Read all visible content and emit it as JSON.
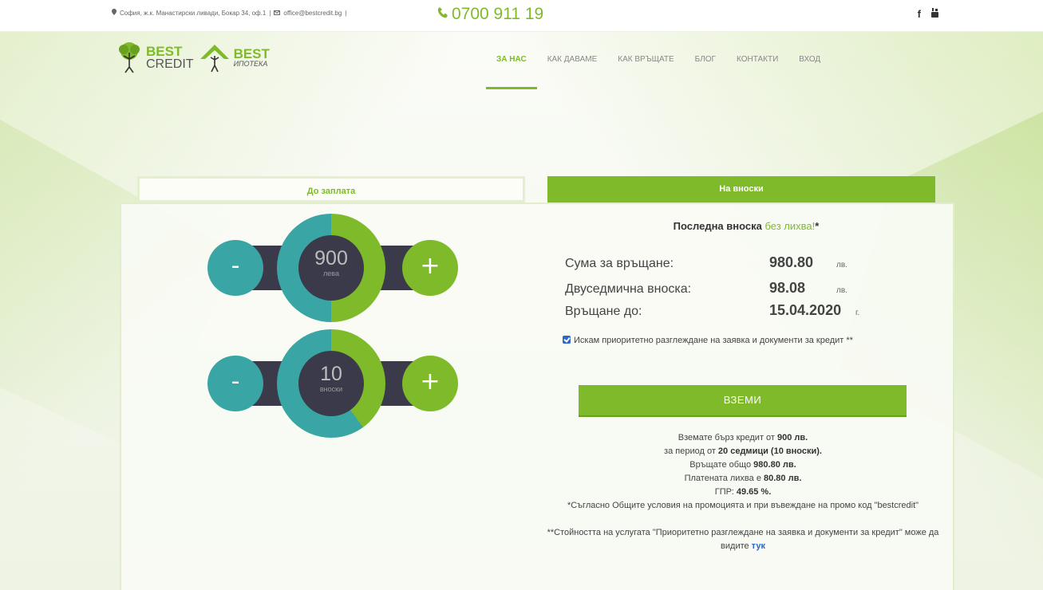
{
  "topbar": {
    "address": "София, ж.к. Манастирски ливади, Бокар 34, оф.1",
    "email": "office@bestcredit.bg",
    "phone": "0700 911 19",
    "social": [
      "f",
      "yt"
    ]
  },
  "logo": {
    "best_credit_1": "BEST",
    "best_credit_2": "CREDIT",
    "best_ipoteka_1": "BEST",
    "best_ipoteka_2": "ИПОТЕКА"
  },
  "nav": {
    "items": [
      "ЗА НАС",
      "КАК ДАВАМЕ",
      "КАК ВРЪЩАТЕ",
      "БЛОГ",
      "КОНТАКТИ",
      "ВХОД"
    ],
    "active_index": 0
  },
  "tabs": {
    "salary": "До заплата",
    "installments": "На вноски"
  },
  "calculator": {
    "amount": {
      "value": "900",
      "unit": "лева",
      "fill_fraction": 0.5
    },
    "installments": {
      "value": "10",
      "unit": "вноски",
      "fill_fraction": 0.4
    },
    "minus_label": "-",
    "plus_label": "+"
  },
  "result": {
    "headline_prefix": "Последна вноска ",
    "headline_green": "без лихва!",
    "headline_suffix": "*",
    "rows": [
      {
        "label": "Сума за връщане:",
        "value": "980.80",
        "unit": "лв."
      },
      {
        "label": "Двуседмична вноска:",
        "value": "98.08",
        "unit": "лв."
      },
      {
        "label": "Връщане до:",
        "value": "15.04.2020",
        "unit": "г."
      }
    ],
    "priority_checkbox": "Искам приоритетно разглеждане на заявка и документи за кредит **",
    "take_button": "ВЗЕМИ"
  },
  "summary": {
    "l1a": "Вземате бърз кредит от ",
    "l1b": "900 лв.",
    "l2a": "за период от ",
    "l2b": "20 седмици (10 вноски).",
    "l3a": "Връщате общо ",
    "l3b": "980.80 лв.",
    "l4a": "Платената лихва е ",
    "l4b": "80.80 лв.",
    "l5a": "ГПР: ",
    "l5b": "49.65 %.",
    "l6": "*Съгласно Общите условия на промоцията и при въвеждане на промо код \"bestcredit\"",
    "l7": "**Стойността на услугата \"Приоритетно разглеждане на заявка и документи за кредит\" може да видите ",
    "l7_link": "тук"
  },
  "colors": {
    "brand_green": "#7fba2a",
    "teal": "#3aa5a5",
    "dark": "#3a3a4a"
  }
}
